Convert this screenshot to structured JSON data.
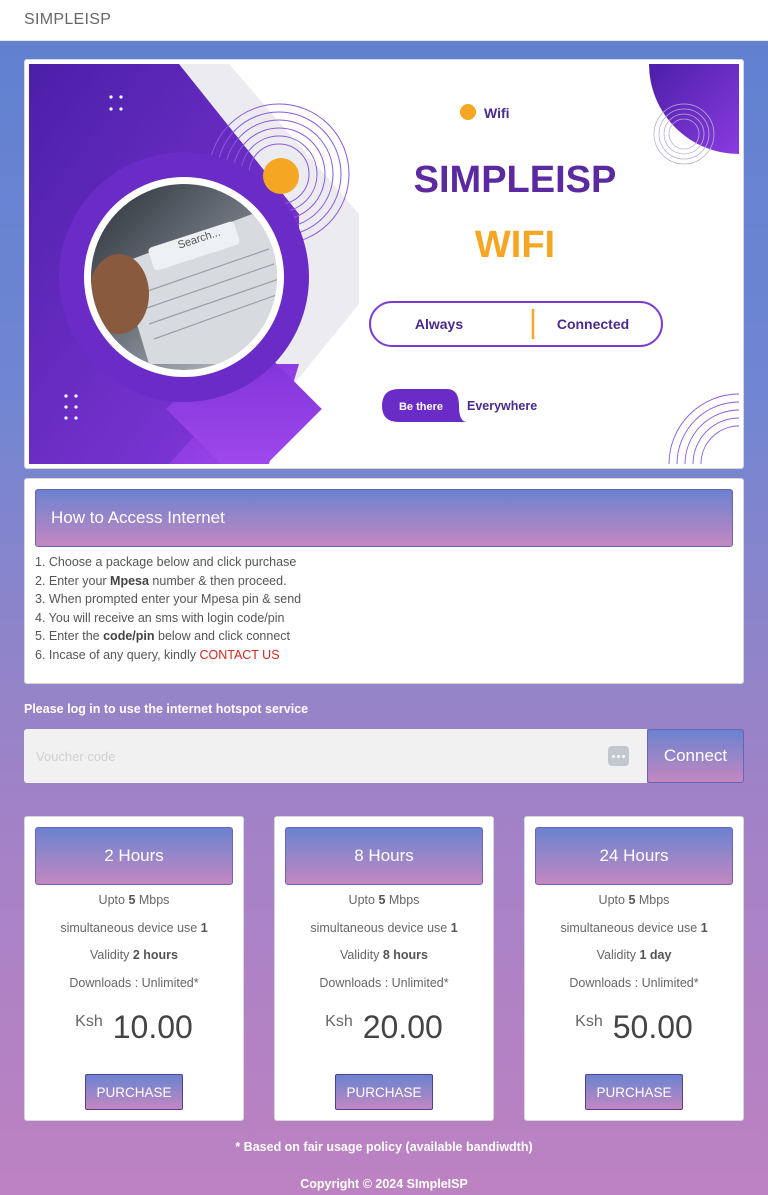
{
  "header": {
    "brand": "SIMPLEISP"
  },
  "banner": {
    "wifi_tag": "Wifi",
    "title": "SIMPLEISP",
    "subtitle": "WIFI",
    "pill_left": "Always",
    "pill_right": "Connected",
    "be_there": "Be there",
    "everywhere": "Everywhere",
    "search_text": "Search..."
  },
  "access": {
    "title": "How to Access Internet",
    "steps": [
      {
        "pre": "1. Choose a package below and click purchase",
        "bold": "",
        "post": ""
      },
      {
        "pre": "2. Enter your ",
        "bold": "Mpesa",
        "post": " number & then proceed."
      },
      {
        "pre": "3. When prompted enter your Mpesa pin & send",
        "bold": "",
        "post": ""
      },
      {
        "pre": "4. You will receive an sms with login code/pin",
        "bold": "",
        "post": ""
      },
      {
        "pre": "5. Enter the ",
        "bold": "code/pin",
        "post": " below and click connect"
      },
      {
        "pre": "6. Incase of any query, kindly ",
        "bold": "",
        "post": ""
      }
    ],
    "contact_link": "CONTACT US"
  },
  "login": {
    "label": "Please log in to use the internet hotspot service",
    "placeholder": "Voucher code",
    "connect": "Connect"
  },
  "plans": [
    {
      "title": "2 Hours",
      "speed_pre": "Upto ",
      "speed_val": "5",
      "speed_post": " Mbps",
      "devices_label": "simultaneous device use ",
      "devices": "1",
      "validity_label": "Validity ",
      "validity": "2 hours",
      "downloads": "Downloads : Unlimited*",
      "currency": "Ksh",
      "price": "10.00",
      "button": "PURCHASE"
    },
    {
      "title": "8 Hours",
      "speed_pre": "Upto ",
      "speed_val": "5",
      "speed_post": " Mbps",
      "devices_label": "simultaneous device use ",
      "devices": "1",
      "validity_label": "Validity ",
      "validity": "8 hours",
      "downloads": "Downloads : Unlimited*",
      "currency": "Ksh",
      "price": "20.00",
      "button": "PURCHASE"
    },
    {
      "title": "24 Hours",
      "speed_pre": "Upto ",
      "speed_val": "5",
      "speed_post": " Mbps",
      "devices_label": "simultaneous device use ",
      "devices": "1",
      "validity_label": "Validity ",
      "validity": "1 day",
      "downloads": "Downloads : Unlimited*",
      "currency": "Ksh",
      "price": "50.00",
      "button": "PURCHASE"
    }
  ],
  "footer": {
    "note": "* Based on fair usage policy (available bandiwdth)",
    "copyright": "Copyright © 2024 SImpleISP"
  },
  "colors": {
    "purple": "#5b2aa0",
    "orange": "#f5a623",
    "accent_red": "#d0271f"
  }
}
